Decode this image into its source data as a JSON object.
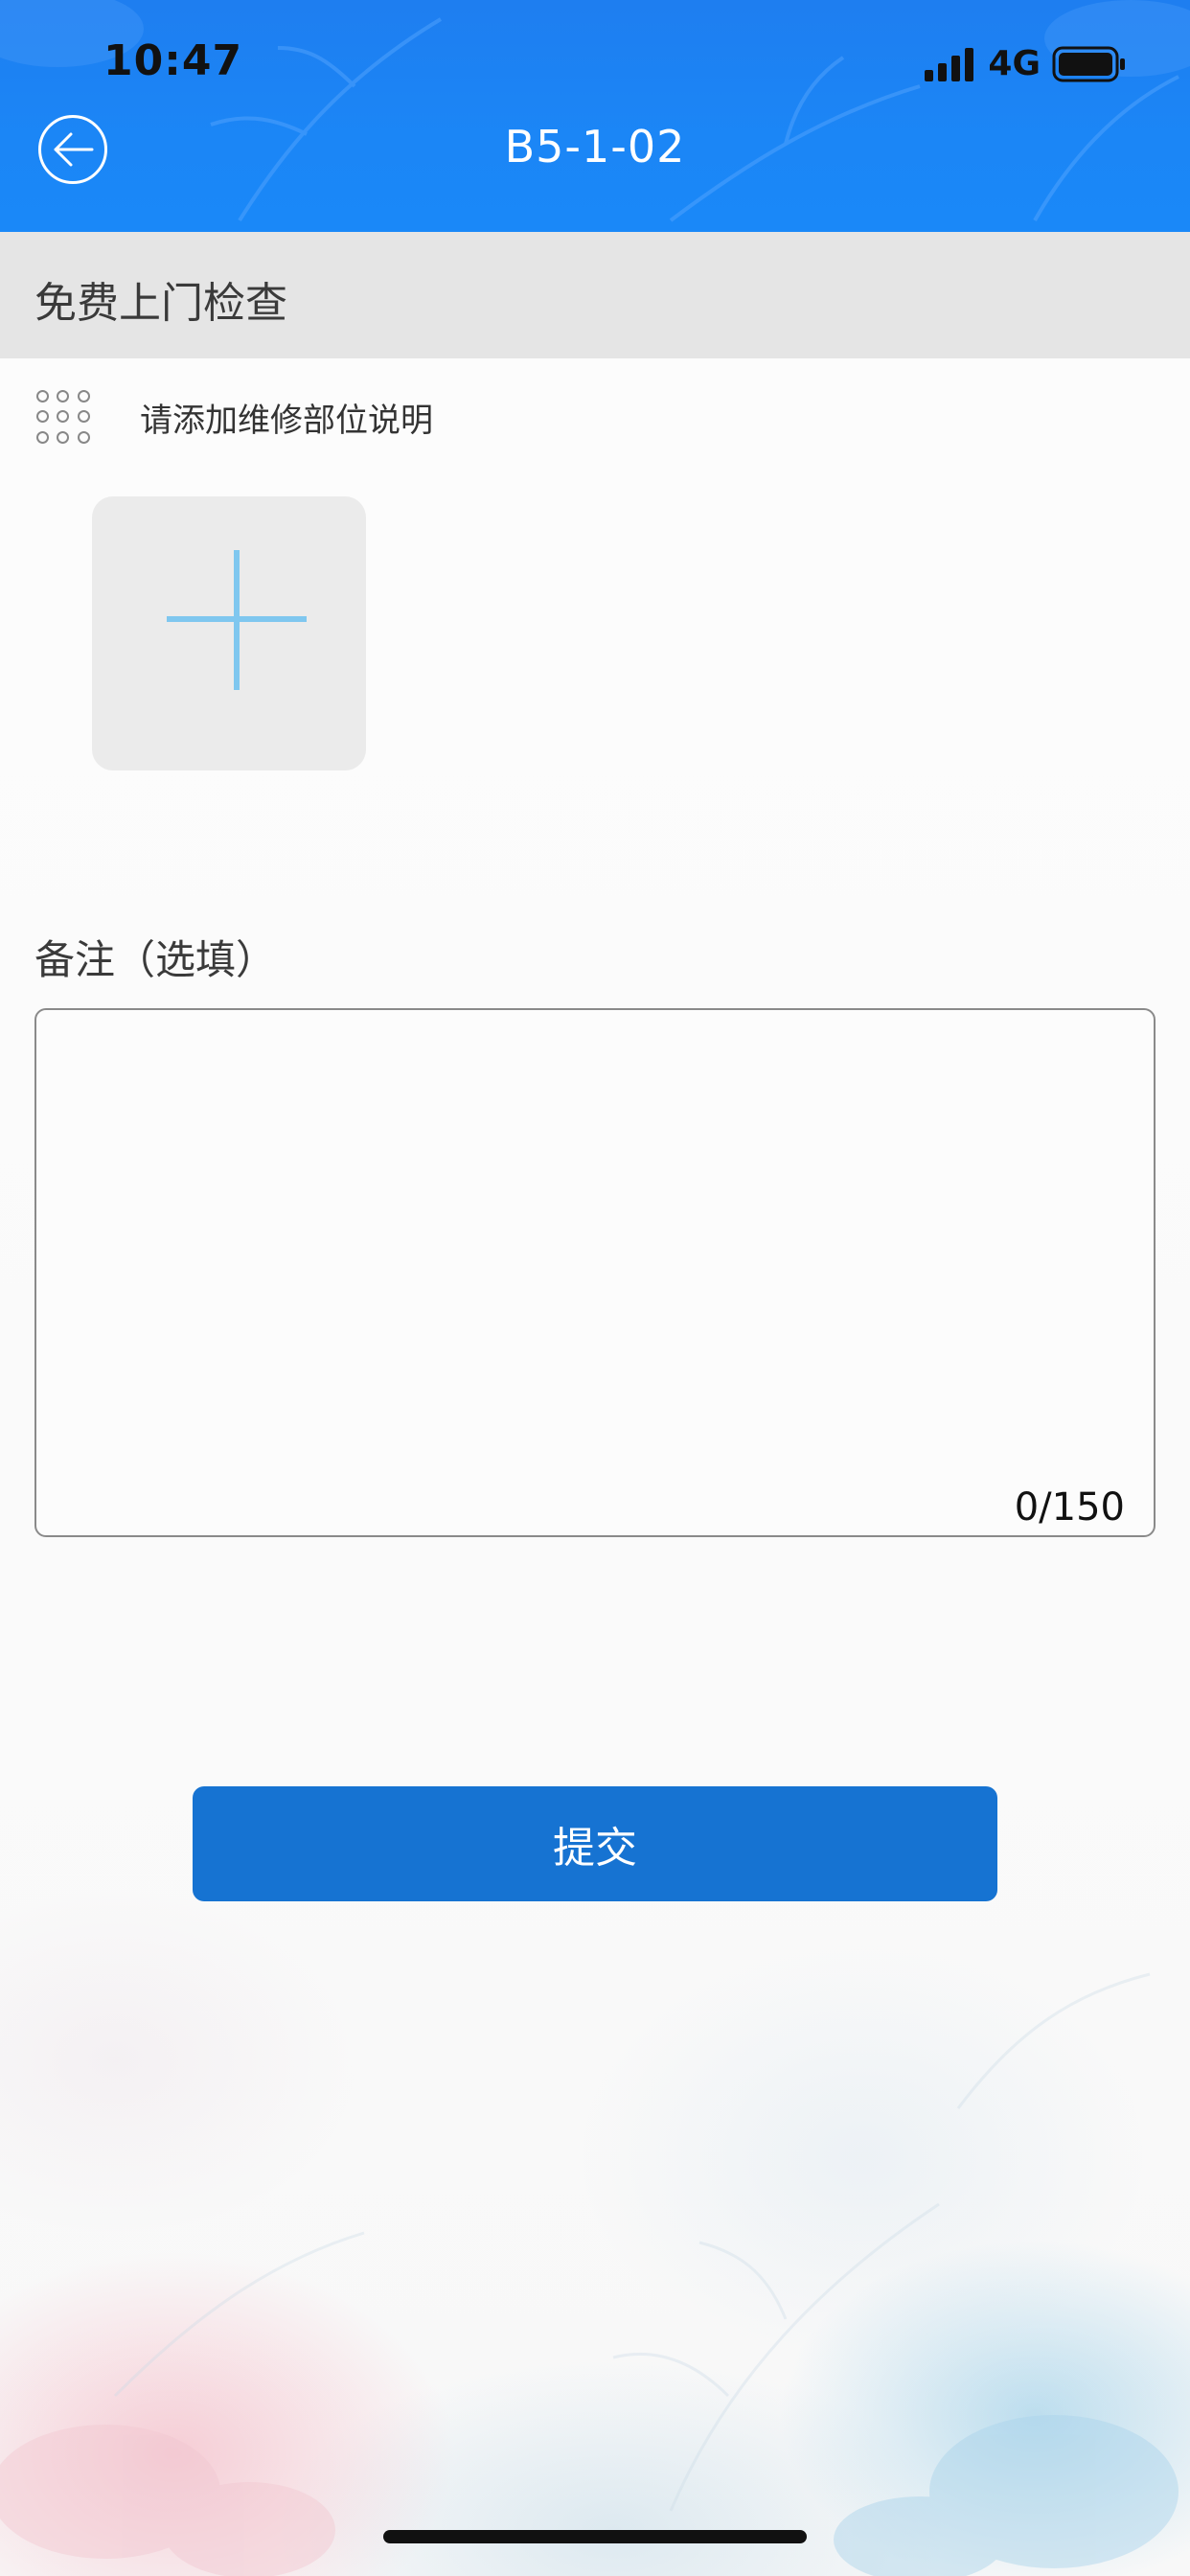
{
  "status_bar": {
    "time": "10:47",
    "network": "4G",
    "signal_icon": "cellular-signal-icon",
    "battery_icon": "battery-icon"
  },
  "nav": {
    "title": "B5-1-02",
    "back_icon": "back-arrow-icon"
  },
  "section": {
    "title": "免费上门检查"
  },
  "repair": {
    "icon": "grid-dots-icon",
    "description_prompt": "请添加维修部位说明",
    "add_icon": "plus-icon"
  },
  "remark": {
    "label": "备注（选填）",
    "value": "",
    "char_count": "0/150"
  },
  "actions": {
    "submit_label": "提交"
  },
  "colors": {
    "header_blue": "#1b86f6",
    "submit_blue": "#1673d2",
    "plus_blue": "#7fc7ef",
    "section_gray": "#e5e5e5"
  }
}
